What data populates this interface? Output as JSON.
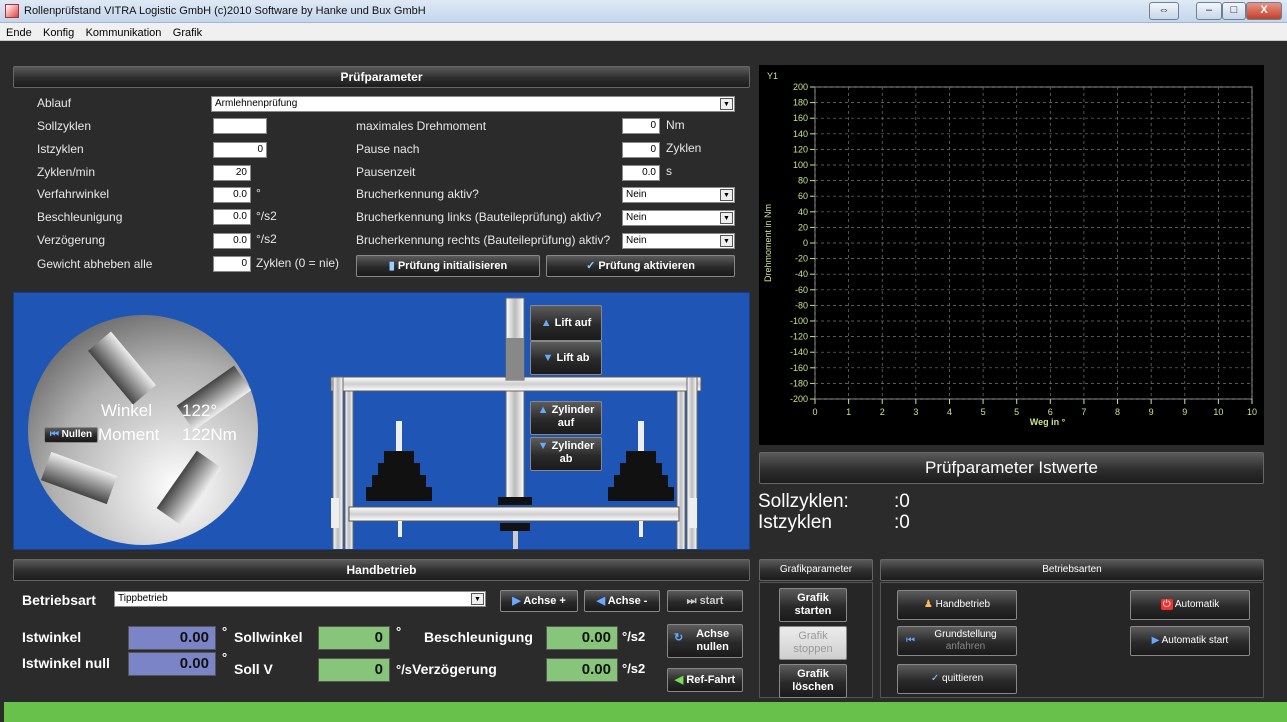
{
  "window": {
    "title": "Rollenprüfstand VITRA Logistic GmbH    (c)2010 Software by  Hanke und Bux GmbH",
    "minimize": "–",
    "maximize": "□",
    "close": "X",
    "restore": "⇔"
  },
  "menu": [
    "Ende",
    "Konfig",
    "Kommunikation",
    "Grafik"
  ],
  "pruef": {
    "header": "Prüfparameter",
    "ablauf_label": "Ablauf",
    "ablauf_value": "Armlehnenprüfung",
    "sollzyklen_label": "Sollzyklen",
    "sollzyklen_value": "",
    "istzyklen_label": "Istzyklen",
    "istzyklen_value": "0",
    "zyklen_min_label": "Zyklen/min",
    "zyklen_min_value": "20",
    "verfahrwinkel_label": "Verfahrwinkel",
    "verfahrwinkel_value": "0.0",
    "verfahrwinkel_unit": "°",
    "beschleunigung_label": "Beschleunigung",
    "beschleunigung_value": "0.0",
    "beschleunigung_unit": "°/s2",
    "verzoegerung_label": "Verzögerung",
    "verzoegerung_value": "0.0",
    "verzoegerung_unit": "°/s2",
    "gewicht_label": "Gewicht abheben alle",
    "gewicht_value": "0",
    "gewicht_unit": "Zyklen (0 = nie)",
    "max_drehmoment_label": "maximales Drehmoment",
    "max_drehmoment_value": "0",
    "max_drehmoment_unit": "Nm",
    "pause_nach_label": "Pause nach",
    "pause_nach_value": "0",
    "pause_nach_unit": "Zyklen",
    "pausenzeit_label": "Pausenzeit",
    "pausenzeit_value": "0.0",
    "pausenzeit_unit": "s",
    "bruch_label": "Brucherkennung aktiv?",
    "bruch_value": "Nein",
    "bruch_links_label": "Brucherkennung links (Bauteileprüfung) aktiv?",
    "bruch_links_value": "Nein",
    "bruch_rechts_label": "Brucherkennung rechts (Bauteileprüfung) aktiv?",
    "bruch_rechts_value": "Nein",
    "init_button": "Prüfung initialisieren",
    "activate_button": "Prüfung aktivieren"
  },
  "scene": {
    "winkel_label": "Winkel",
    "winkel_value": "122°",
    "moment_label": "Moment",
    "moment_value": "122Nm",
    "nullen_button": "Nullen",
    "lift_auf": "Lift auf",
    "lift_ab": "Lift ab",
    "zylinder_auf_1": "Zylinder",
    "zylinder_auf_2": "auf",
    "zylinder_ab_1": "Zylinder",
    "zylinder_ab_2": "ab"
  },
  "chart_data": {
    "type": "line",
    "title": "",
    "y_axis_title": "Y1",
    "xlabel": "Weg in °",
    "ylabel": "Drehmoment in Nm",
    "xlim": [
      0,
      10
    ],
    "ylim": [
      -200,
      200
    ],
    "x_ticks": [
      0,
      1,
      2,
      3,
      4,
      5,
      5,
      6,
      7,
      8,
      9,
      9,
      10,
      10
    ],
    "y_ticks": [
      200,
      180,
      160,
      140,
      120,
      100,
      80,
      60,
      40,
      20,
      0,
      -20,
      -40,
      -60,
      -80,
      -100,
      -120,
      -140,
      -160,
      -180,
      -200
    ],
    "grid": true,
    "series": []
  },
  "istwerte": {
    "header": "Prüfparameter Istwerte",
    "sollzyklen_label": "Sollzyklen:",
    "sollzyklen_value": ":0",
    "istzyklen_label": "Istzyklen",
    "istzyklen_value": ":0"
  },
  "hand": {
    "header": "Handbetrieb",
    "betriebsart_label": "Betriebsart",
    "betriebsart_value": "Tippbetrieb",
    "achse_plus": "Achse +",
    "achse_minus": "Achse -",
    "start": "start",
    "istwinkel_label": "Istwinkel",
    "istwinkel_value": "0.00",
    "istwinkel_unit": "°",
    "istwinkel_null_label": "Istwinkel null",
    "istwinkel_null_value": "0.00",
    "istwinkel_null_unit": "°",
    "sollwinkel_label": "Sollwinkel",
    "sollwinkel_value": "0",
    "sollwinkel_unit": "°",
    "soll_v_label": "Soll V",
    "soll_v_value": "0",
    "soll_v_unit": "°/s",
    "beschleunigung_label": "Beschleunigung",
    "beschleunigung_value": "0.00",
    "beschleunigung_unit": "°/s2",
    "verzoegerung_label": "Verzögerung",
    "verzoegerung_value": "0.00",
    "verzoegerung_unit": "°/s2",
    "achse_nullen_1": "Achse",
    "achse_nullen_2": "nullen",
    "ref_fahrt": "Ref-Fahrt"
  },
  "grafik": {
    "header": "Grafikparameter",
    "starten_1": "Grafik",
    "starten_2": "starten",
    "stoppen_1": "Grafik",
    "stoppen_2": "stoppen",
    "loeschen_1": "Grafik",
    "loeschen_2": "löschen"
  },
  "betriebsarten": {
    "header": "Betriebsarten",
    "handbetrieb": "Handbetrieb",
    "grundstellung_1": "Grundstellung",
    "grundstellung_2": "anfahren",
    "quittieren": "quittieren",
    "automatik": "Automatik",
    "automatik_start": "Automatik start"
  }
}
